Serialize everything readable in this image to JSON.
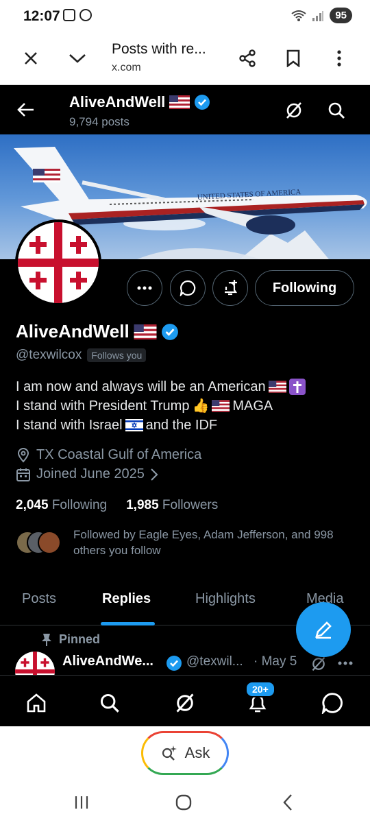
{
  "status_bar": {
    "time": "12:07",
    "battery": "95"
  },
  "browser": {
    "title": "Posts with re...",
    "url": "x.com"
  },
  "header": {
    "name": "AliveAndWell",
    "posts": "9,794 posts"
  },
  "profile": {
    "name": "AliveAndWell",
    "handle": "@texwilcox",
    "follows_you": "Follows you",
    "following_button": "Following",
    "bio": [
      "I am now and always will be an American",
      "I stand with President Trump",
      "MAGA",
      "I stand with Israel",
      "and the IDF"
    ],
    "location": "TX Coastal Gulf of America",
    "joined": "Joined June 2025",
    "following_count": "2,045",
    "following_label": "Following",
    "followers_count": "1,985",
    "followers_label": "Followers",
    "followed_by": "Followed by Eagle Eyes, Adam Jefferson, and 998 others you follow",
    "banner_text": "UNITED STATES OF AMERICA"
  },
  "tabs": [
    {
      "label": "Posts"
    },
    {
      "label": "Replies"
    },
    {
      "label": "Highlights"
    },
    {
      "label": "Media"
    }
  ],
  "pinned": {
    "label": "Pinned",
    "name": "AliveAndWe...",
    "handle": "@texwil...",
    "date": "· May 5"
  },
  "bottom_nav": {
    "notif_badge": "20+"
  },
  "ask": {
    "label": "Ask"
  },
  "colors": {
    "accent": "#1d9bf0",
    "background": "#000000",
    "muted": "#8b98a5",
    "cross_red": "#c8102e"
  }
}
